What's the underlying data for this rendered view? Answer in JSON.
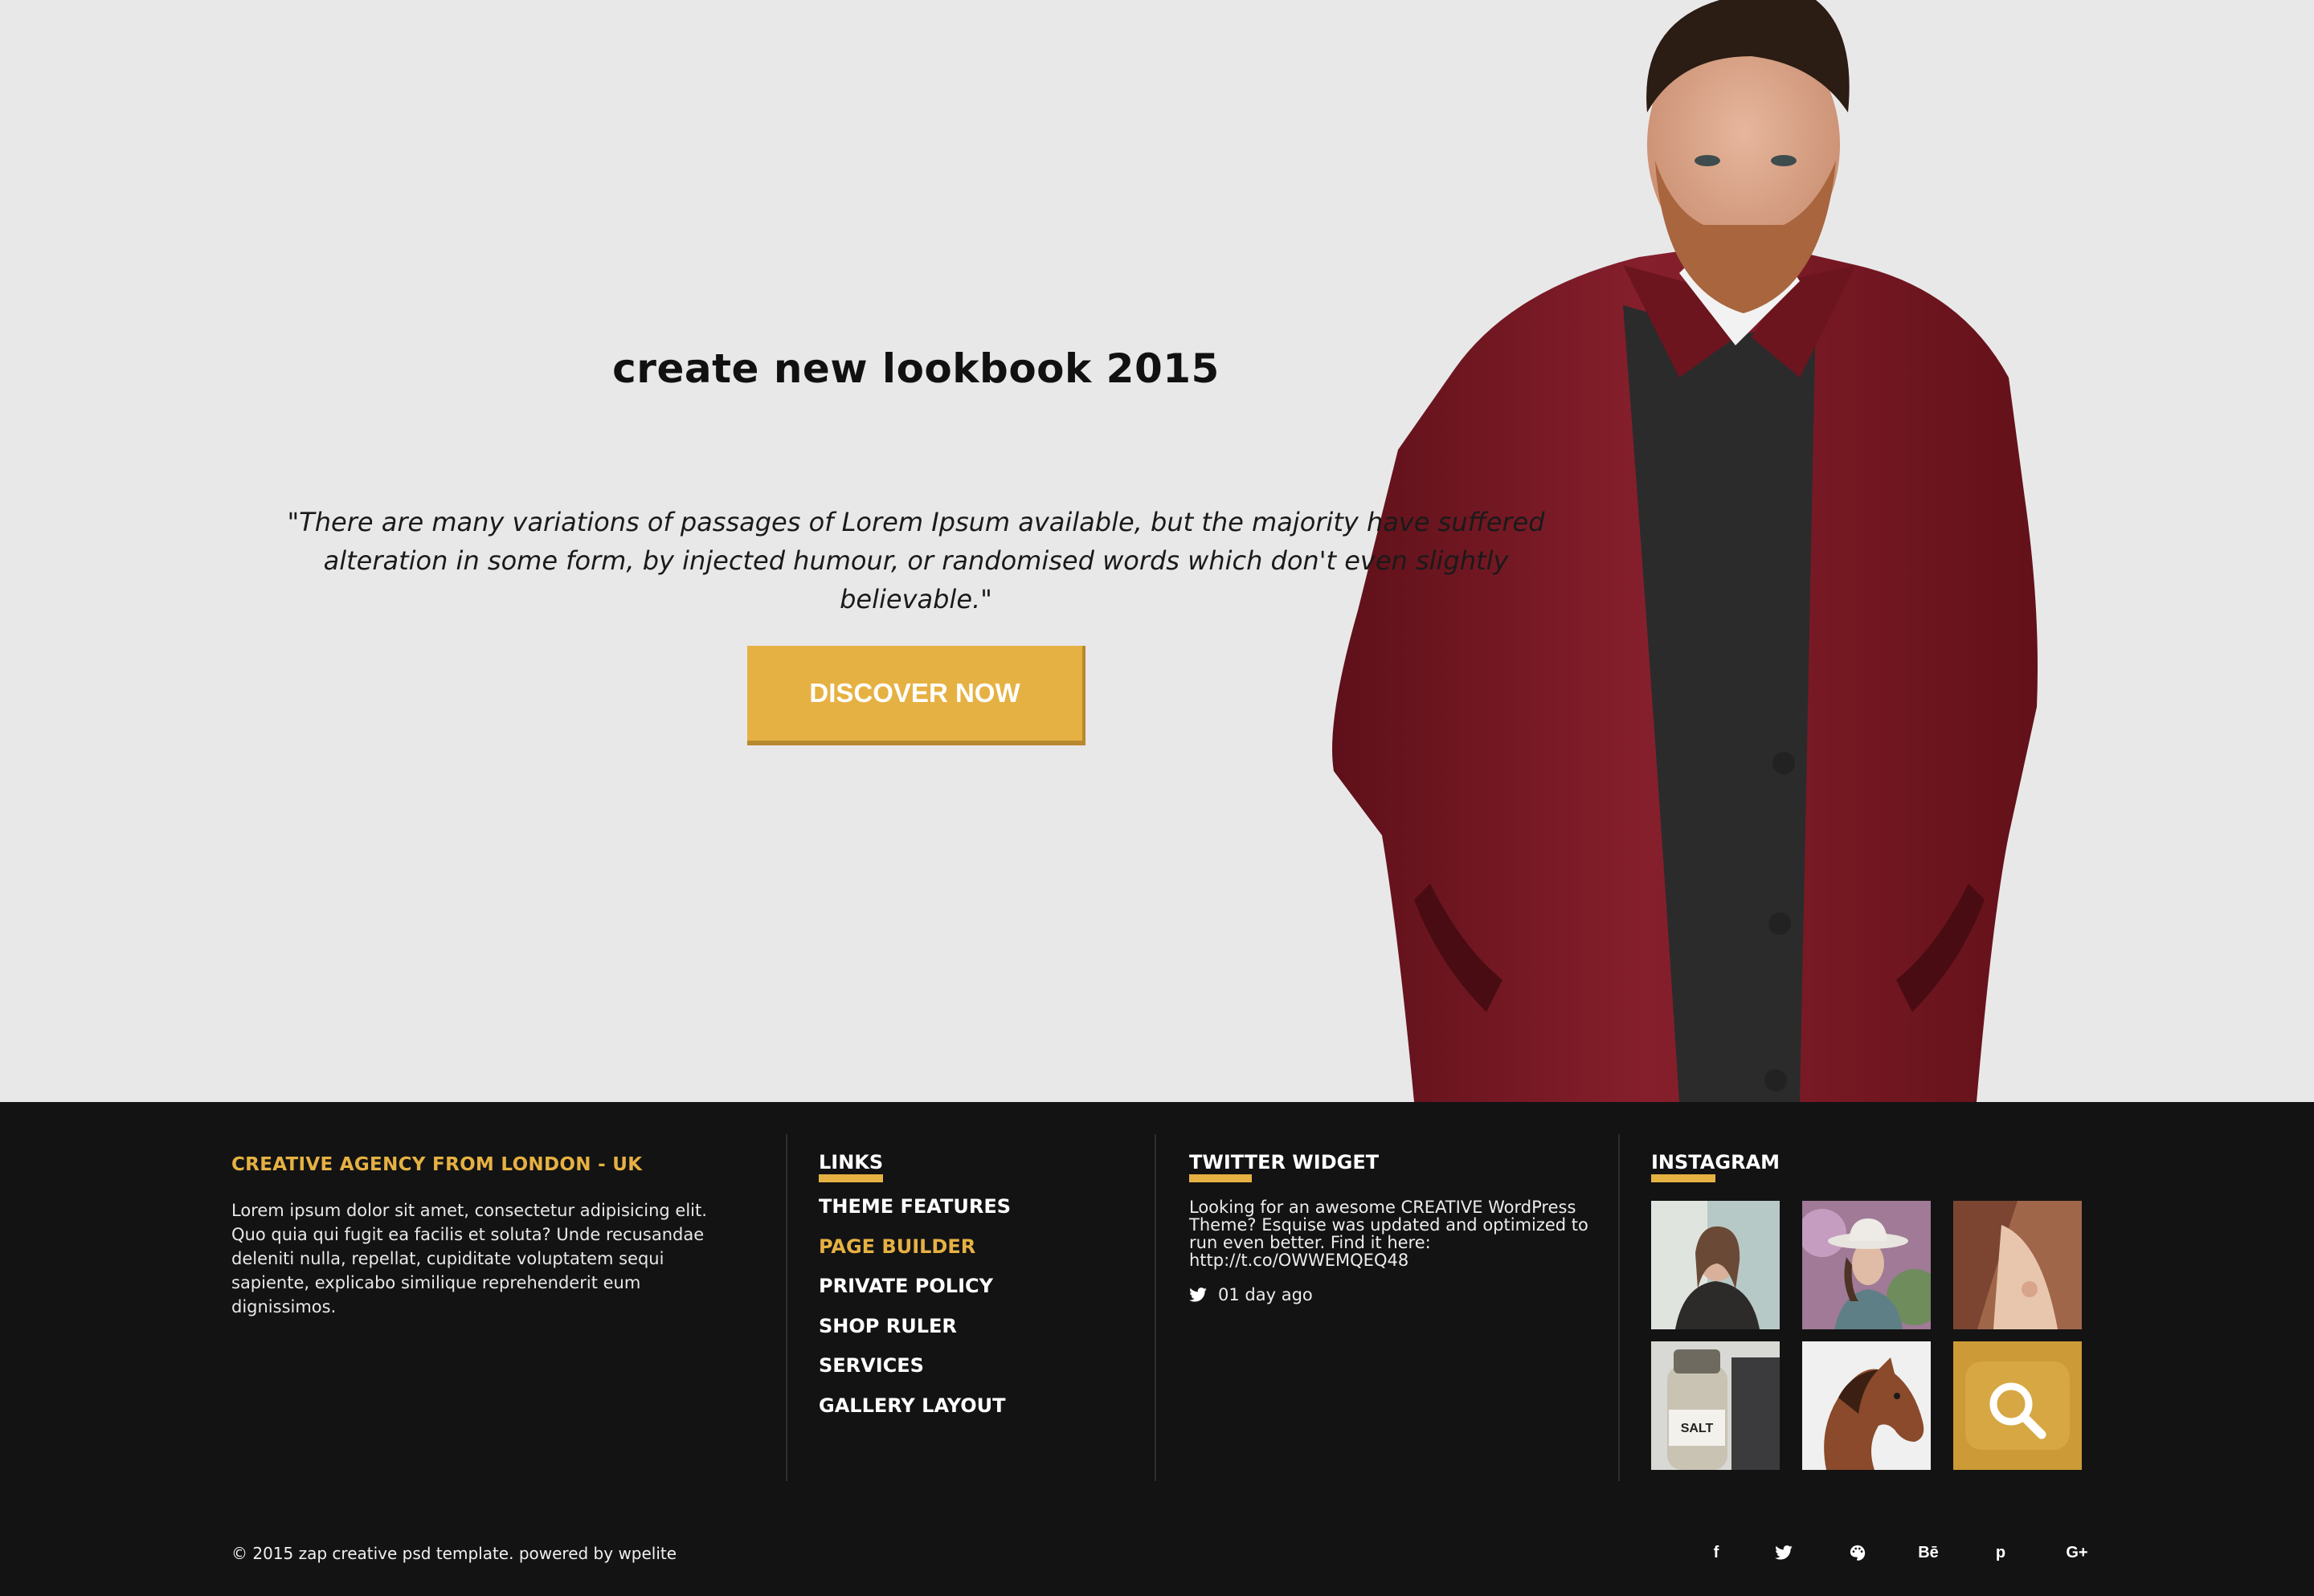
{
  "hero": {
    "title": "create new lookbook 2015",
    "quote": "\"There are many variations of passages of Lorem Ipsum available, but the majority have suffered alteration in some form, by injected humour, or randomised words which don't even slightly believable.\"",
    "cta_label": "DISCOVER NOW"
  },
  "footer": {
    "about": {
      "title": "CREATIVE AGENCY FROM LONDON - UK",
      "text": "Lorem ipsum dolor sit amet, consectetur adipisicing elit. Quo quia qui fugit ea facilis et soluta? Unde recusandae deleniti nulla, repellat, cupiditate voluptatem sequi sapiente, explicabo similique reprehenderit eum dignissimos."
    },
    "links": {
      "title": "LINKS",
      "items": [
        {
          "label": "THEME FEATURES"
        },
        {
          "label": "PAGE BUILDER",
          "active": true
        },
        {
          "label": "PRIVATE POLICY"
        },
        {
          "label": "SHOP RULER"
        },
        {
          "label": "SERVICES"
        },
        {
          "label": "GALLERY LAYOUT"
        }
      ]
    },
    "twitter": {
      "title": "TWITTER WIDGET",
      "text": "Looking for an awesome CREATIVE WordPress Theme? Esquise was updated and optimized to run even better. Find it here: http://t.co/OWWEMQEQ48",
      "time": "01 day ago",
      "icon": "twitter-icon"
    },
    "instagram": {
      "title": "INSTAGRAM",
      "items": [
        {
          "name": "instagram-photo-woman-sweater"
        },
        {
          "name": "instagram-photo-woman-hat"
        },
        {
          "name": "instagram-photo-dress-detail"
        },
        {
          "name": "instagram-photo-salt-bottle"
        },
        {
          "name": "instagram-photo-horse"
        },
        {
          "name": "instagram-more",
          "icon": "search-icon"
        }
      ]
    },
    "copyright": "© 2015 zap creative psd template. powered by wpelite",
    "social": [
      {
        "icon": "facebook-icon",
        "glyph": "f"
      },
      {
        "icon": "twitter-icon"
      },
      {
        "icon": "palette-icon"
      },
      {
        "icon": "behance-icon",
        "glyph": "Bē"
      },
      {
        "icon": "pinterest-icon",
        "glyph": "p"
      },
      {
        "icon": "google-plus-icon",
        "glyph": "G+"
      }
    ]
  },
  "colors": {
    "accent": "#e6b143",
    "footer_bg": "#131313",
    "hero_bg": "#e9e8e9",
    "coat": "#7a1a26"
  }
}
